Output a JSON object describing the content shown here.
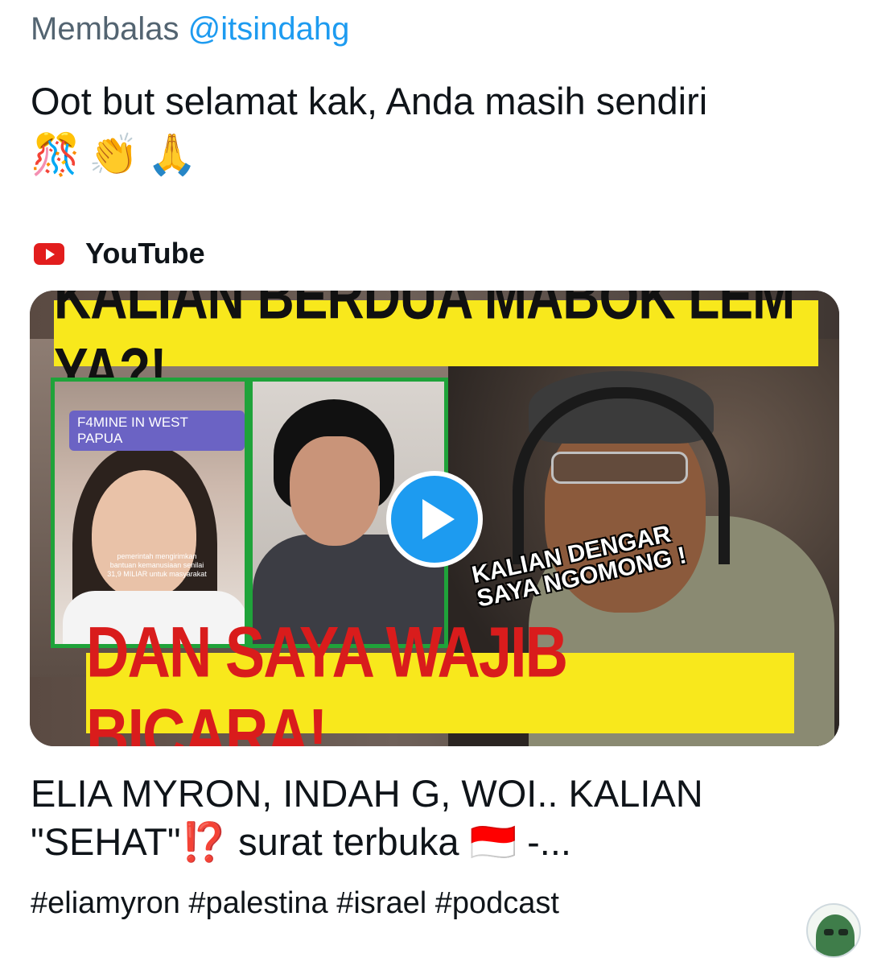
{
  "reply": {
    "prefix": "Membalas",
    "handle": "@itsindahg"
  },
  "tweet": {
    "text": "Oot but selamat kak, Anda masih sendiri",
    "emojis": [
      "🎊",
      "👏",
      "🙏"
    ]
  },
  "card": {
    "source_name": "YouTube",
    "thumbnail": {
      "top_banner": "KALIAN BERDUA MABOK LEM YA?!",
      "overlay_label": "F4MINE IN WEST PAPUA",
      "tiktok_caption": "pemerintah mengirimkan bantuan kemanusiaan senilai 31,9 MILIAR untuk masyarakat",
      "middle_caption_line1": "KALIAN DENGAR",
      "middle_caption_line2": "SAYA NGOMONG !",
      "bottom_banner": "DAN SAYA WAJIB BICARA!"
    },
    "title": "ELIA MYRON, INDAH G, WOI.. KALIAN \"SEHAT\"⁉️ surat terbuka 🇮🇩 -...",
    "description": "#eliamyron #palestina #israel #podcast"
  },
  "icons": {
    "youtube": "youtube-logo-icon",
    "play": "play-icon",
    "avatar": "avatar-icon"
  },
  "colors": {
    "link": "#1d9bf0",
    "secondary_text": "#536471",
    "primary_text": "#0f1419",
    "youtube_red": "#e21d1d",
    "banner_yellow": "#f8e81c",
    "banner_red_text": "#d91c1c"
  }
}
